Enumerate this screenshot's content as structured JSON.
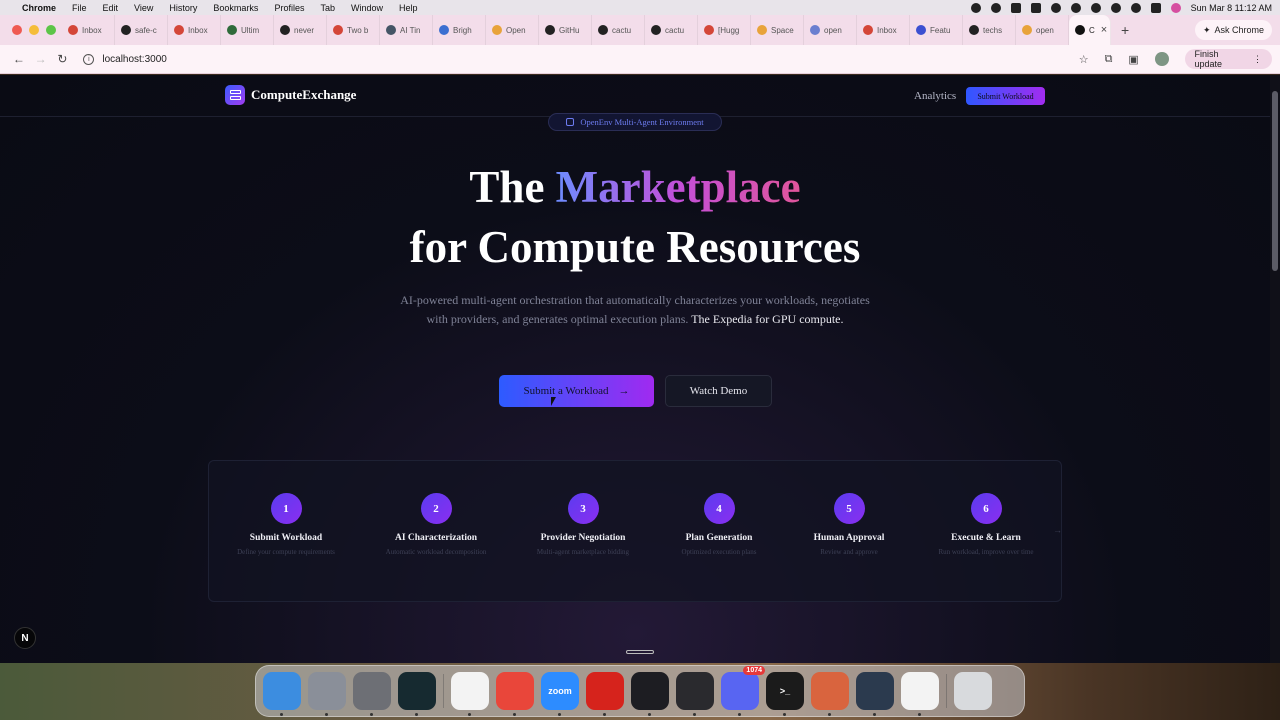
{
  "menubar": {
    "app": "Chrome",
    "items": [
      "File",
      "Edit",
      "View",
      "History",
      "Bookmarks",
      "Profiles",
      "Tab",
      "Window",
      "Help"
    ],
    "clock": "Sun Mar 8  11:12 AM"
  },
  "tabs": [
    {
      "label": "Inbox",
      "color": "#d44638"
    },
    {
      "label": "safe-c",
      "color": "#222222"
    },
    {
      "label": "Inbox",
      "color": "#d44638"
    },
    {
      "label": "Ultim",
      "color": "#2f6b3a"
    },
    {
      "label": "never",
      "color": "#222222"
    },
    {
      "label": "Two b",
      "color": "#d44638"
    },
    {
      "label": "AI Tin",
      "color": "#445566"
    },
    {
      "label": "Brigh",
      "color": "#3b6fd1"
    },
    {
      "label": "Open",
      "color": "#e8a33a"
    },
    {
      "label": "GitHu",
      "color": "#222222"
    },
    {
      "label": "cactu",
      "color": "#222222"
    },
    {
      "label": "cactu",
      "color": "#222222"
    },
    {
      "label": "[Hugg",
      "color": "#d44638"
    },
    {
      "label": "Space",
      "color": "#e8a33a"
    },
    {
      "label": "open",
      "color": "#6a7fd0"
    },
    {
      "label": "Inbox",
      "color": "#d44638"
    },
    {
      "label": "Featu",
      "color": "#3b4fd1"
    },
    {
      "label": "techs",
      "color": "#222222"
    },
    {
      "label": "open",
      "color": "#e8a33a"
    }
  ],
  "active_tab": {
    "label": "C"
  },
  "ask_chrome": "Ask Chrome",
  "address": {
    "url": "localhost:3000"
  },
  "finish_update": "Finish update",
  "site": {
    "logo_text": "ComputeExchange",
    "nav_analytics": "Analytics",
    "nav_submit": "Submit Workload",
    "badge": "OpenEnv Multi-Agent Environment",
    "hero_the": "The",
    "hero_marketplace": "Marketplace",
    "hero_line2": "for Compute Resources",
    "hero_sub": "AI-powered multi-agent orchestration that automatically characterizes your workloads, negotiates with providers, and generates optimal execution plans.",
    "hero_sub_highlight": "The Expedia for GPU compute.",
    "cta_primary": "Submit a Workload",
    "cta_secondary": "Watch Demo",
    "steps": [
      {
        "num": "1",
        "title": "Submit Workload",
        "desc": "Define your compute requirements"
      },
      {
        "num": "2",
        "title": "AI Characterization",
        "desc": "Automatic workload decomposition"
      },
      {
        "num": "3",
        "title": "Provider Negotiation",
        "desc": "Multi-agent marketplace bidding"
      },
      {
        "num": "4",
        "title": "Plan Generation",
        "desc": "Optimized execution plans"
      },
      {
        "num": "5",
        "title": "Human Approval",
        "desc": "Review and approve"
      },
      {
        "num": "6",
        "title": "Execute & Learn",
        "desc": "Run workload, improve over time"
      }
    ],
    "next_badge": "N"
  },
  "dock": {
    "apps": [
      {
        "name": "finder",
        "color": "#3c8de0",
        "label": ""
      },
      {
        "name": "launchpad",
        "color": "#8a8f99",
        "label": ""
      },
      {
        "name": "settings",
        "color": "#6d6f75",
        "label": ""
      },
      {
        "name": "app-dark",
        "color": "#162a30",
        "label": ""
      },
      {
        "name": "chatgpt",
        "color": "#f3f3f3",
        "label": ""
      },
      {
        "name": "chrome",
        "color": "#e9463a",
        "label": ""
      },
      {
        "name": "zoom",
        "color": "#2d8cff",
        "label": "zoom"
      },
      {
        "name": "acrobat",
        "color": "#d6231c",
        "label": ""
      },
      {
        "name": "stats",
        "color": "#1d1d22",
        "label": ""
      },
      {
        "name": "cube",
        "color": "#2a2a2e",
        "label": ""
      },
      {
        "name": "discord",
        "color": "#5865f2",
        "label": "",
        "badge": "1074"
      },
      {
        "name": "terminal",
        "color": "#1b1b1b",
        "label": ">_"
      },
      {
        "name": "claude",
        "color": "#d9643e",
        "label": ""
      },
      {
        "name": "quicktime",
        "color": "#2b3a4e",
        "label": ""
      },
      {
        "name": "chatgpt-2",
        "color": "#f3f3f3",
        "label": ""
      }
    ],
    "trash": {
      "name": "trash",
      "color": "#d8dadd"
    }
  }
}
